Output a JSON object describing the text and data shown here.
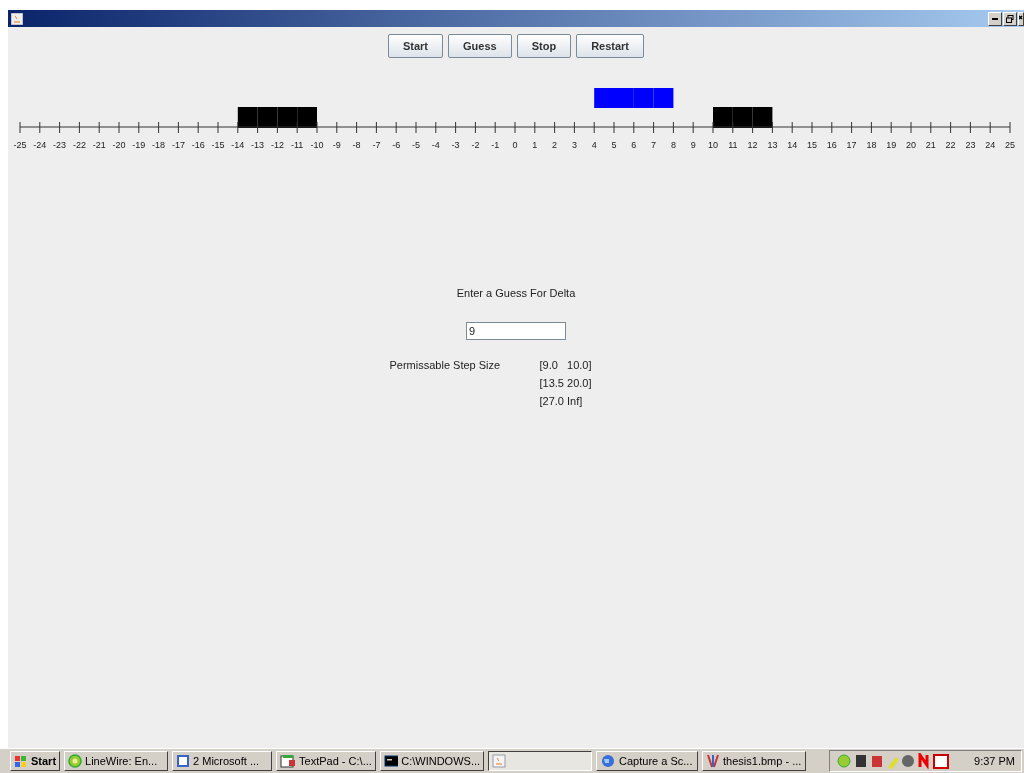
{
  "buttons": [
    {
      "label": "Start"
    },
    {
      "label": "Guess"
    },
    {
      "label": "Stop"
    },
    {
      "label": "Restart"
    }
  ],
  "number_line": {
    "ticks": [
      {
        "label": "-25",
        "blocked": false,
        "guessed": false
      },
      {
        "label": "-24",
        "blocked": false,
        "guessed": false
      },
      {
        "label": "-23",
        "blocked": false,
        "guessed": false
      },
      {
        "label": "-22",
        "blocked": false,
        "guessed": false
      },
      {
        "label": "-21",
        "blocked": false,
        "guessed": false
      },
      {
        "label": "-20",
        "blocked": false,
        "guessed": false
      },
      {
        "label": "-19",
        "blocked": false,
        "guessed": false
      },
      {
        "label": "-18",
        "blocked": false,
        "guessed": false
      },
      {
        "label": "-17",
        "blocked": false,
        "guessed": false
      },
      {
        "label": "-16",
        "blocked": false,
        "guessed": false
      },
      {
        "label": "-15",
        "blocked": false,
        "guessed": false
      },
      {
        "label": "-14",
        "blocked": true,
        "guessed": false
      },
      {
        "label": "-13",
        "blocked": true,
        "guessed": false
      },
      {
        "label": "-12",
        "blocked": true,
        "guessed": false
      },
      {
        "label": "-11",
        "blocked": true,
        "guessed": false
      },
      {
        "label": "-10",
        "blocked": false,
        "guessed": false
      },
      {
        "label": "-9",
        "blocked": false,
        "guessed": false
      },
      {
        "label": "-8",
        "blocked": false,
        "guessed": false
      },
      {
        "label": "-7",
        "blocked": false,
        "guessed": false
      },
      {
        "label": "-6",
        "blocked": false,
        "guessed": false
      },
      {
        "label": "-5",
        "blocked": false,
        "guessed": false
      },
      {
        "label": "-4",
        "blocked": false,
        "guessed": false
      },
      {
        "label": "-3",
        "blocked": false,
        "guessed": false
      },
      {
        "label": "-2",
        "blocked": false,
        "guessed": false
      },
      {
        "label": "-1",
        "blocked": false,
        "guessed": false
      },
      {
        "label": "0",
        "blocked": false,
        "guessed": false
      },
      {
        "label": "1",
        "blocked": false,
        "guessed": false
      },
      {
        "label": "2",
        "blocked": false,
        "guessed": false
      },
      {
        "label": "3",
        "blocked": false,
        "guessed": false
      },
      {
        "label": "4",
        "blocked": false,
        "guessed": true
      },
      {
        "label": "5",
        "blocked": false,
        "guessed": true
      },
      {
        "label": "6",
        "blocked": false,
        "guessed": true
      },
      {
        "label": "7",
        "blocked": false,
        "guessed": true
      },
      {
        "label": "8",
        "blocked": false,
        "guessed": false
      },
      {
        "label": "9",
        "blocked": false,
        "guessed": false
      },
      {
        "label": "10",
        "blocked": true,
        "guessed": false
      },
      {
        "label": "11",
        "blocked": true,
        "guessed": false
      },
      {
        "label": "12",
        "blocked": true,
        "guessed": false
      },
      {
        "label": "13",
        "blocked": false,
        "guessed": false
      },
      {
        "label": "14",
        "blocked": false,
        "guessed": false
      },
      {
        "label": "15",
        "blocked": false,
        "guessed": false
      },
      {
        "label": "16",
        "blocked": false,
        "guessed": false
      },
      {
        "label": "17",
        "blocked": false,
        "guessed": false
      },
      {
        "label": "18",
        "blocked": false,
        "guessed": false
      },
      {
        "label": "19",
        "blocked": false,
        "guessed": false
      },
      {
        "label": "20",
        "blocked": false,
        "guessed": false
      },
      {
        "label": "21",
        "blocked": false,
        "guessed": false
      },
      {
        "label": "22",
        "blocked": false,
        "guessed": false
      },
      {
        "label": "23",
        "blocked": false,
        "guessed": false
      },
      {
        "label": "24",
        "blocked": false,
        "guessed": false
      },
      {
        "label": "25"
      }
    ]
  },
  "prompt": "Enter a Guess For Delta",
  "guess_field": {
    "value": "9"
  },
  "step_size": {
    "label": "Permissable Step Size",
    "ranges": [
      "[9.0   10.0]",
      "[13.5 20.0]",
      "[27.0 Inf]"
    ]
  },
  "taskbar": {
    "start": "Start",
    "items": [
      {
        "label": "LineWire: En...",
        "kind": "circle",
        "selected": false
      },
      {
        "label": "2 Microsoft ...",
        "kind": "word",
        "selected": false
      },
      {
        "label": "TextPad - C:\\...",
        "kind": "pad",
        "selected": false
      },
      {
        "label": "C:\\WINDOWS...",
        "kind": "console",
        "selected": false
      },
      {
        "kind": "java",
        "selected": true
      },
      {
        "label": "Capture a Sc...",
        "kind": "capture",
        "selected": false
      },
      {
        "label": "thesis1.bmp - ...",
        "kind": "paint",
        "selected": false
      }
    ],
    "clock": "9:37 PM"
  }
}
